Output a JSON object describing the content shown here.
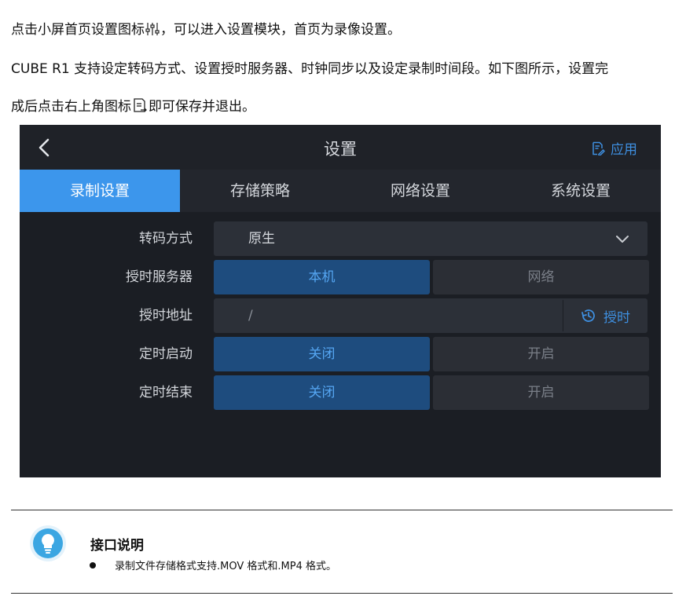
{
  "doc": {
    "para1": {
      "before": "点击小屏首页设置图标",
      "after": "，可以进入设置模块，首页为录像设置。",
      "icon": "sliders-icon"
    },
    "para2": "CUBE R1 支持设定转码方式、设置授时服务器、时钟同步以及设定录制时间段。如下图所示，设置完",
    "para3": {
      "before": "成后点击右上角图标",
      "after": "即可保存并退出。",
      "icon": "save-document-icon"
    }
  },
  "device": {
    "title": "设置",
    "back_icon": "chevron-left-icon",
    "apply_label": "应用",
    "apply_icon": "document-edit-icon",
    "tabs": [
      {
        "label": "录制设置",
        "active": true
      },
      {
        "label": "存储策略",
        "active": false
      },
      {
        "label": "网络设置",
        "active": false
      },
      {
        "label": "系统设置",
        "active": false
      }
    ],
    "transcode": {
      "label": "转码方式",
      "value": "原生",
      "icon": "chevron-down-icon"
    },
    "time_server": {
      "label": "授时服务器",
      "options": [
        "本机",
        "网络"
      ],
      "selected": "本机"
    },
    "time_address": {
      "label": "授时地址",
      "value": "/",
      "button_label": "授时",
      "button_icon": "clock-sync-icon"
    },
    "timer_start": {
      "label": "定时启动",
      "options": [
        "关闭",
        "开启"
      ],
      "selected": "关闭"
    },
    "timer_end": {
      "label": "定时结束",
      "options": [
        "关闭",
        "开启"
      ],
      "selected": "关闭"
    },
    "colors": {
      "accent": "#3c96ec",
      "selected_bg": "#1e4c7e",
      "panel_bg": "#1b1e24"
    }
  },
  "note": {
    "icon": "lightbulb-icon",
    "title": "接口说明",
    "items": [
      "录制文件存储格式支持.MOV 格式和.MP4 格式。"
    ]
  }
}
